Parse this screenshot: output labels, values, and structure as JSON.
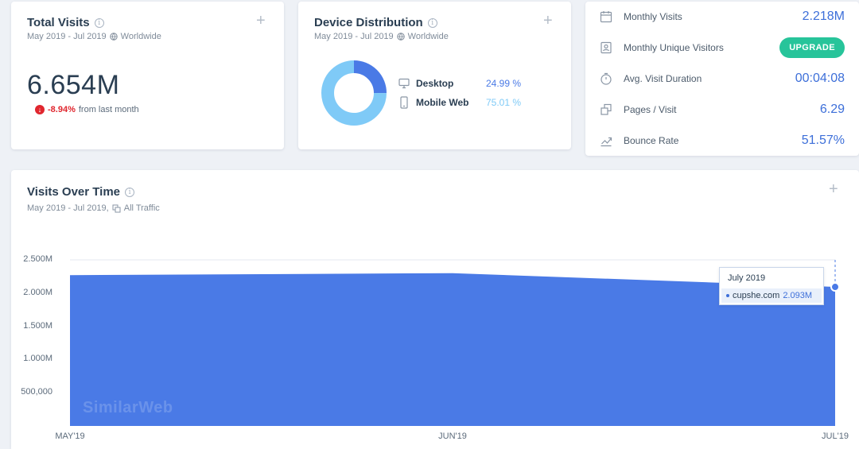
{
  "total_visits": {
    "title": "Total Visits",
    "date_range": "May 2019 - Jul 2019",
    "region": "Worldwide",
    "value": "6.654M",
    "change": "-8.94%",
    "change_suffix": "from last month"
  },
  "device_distribution": {
    "title": "Device Distribution",
    "date_range": "May 2019 - Jul 2019",
    "region": "Worldwide",
    "devices": [
      {
        "label": "Desktop",
        "value": "24.99 %",
        "share": 24.99,
        "color": "#4a7ae6"
      },
      {
        "label": "Mobile Web",
        "value": "75.01 %",
        "share": 75.01,
        "color": "#7fcaf7"
      }
    ]
  },
  "metrics": [
    {
      "label": "Monthly Visits",
      "value": "2.218M",
      "icon": "calendar-icon"
    },
    {
      "label": "Monthly Unique Visitors",
      "button": "UPGRADE",
      "icon": "person-card-icon"
    },
    {
      "label": "Avg. Visit Duration",
      "value": "00:04:08",
      "icon": "timer-icon"
    },
    {
      "label": "Pages / Visit",
      "value": "6.29",
      "icon": "pages-icon"
    },
    {
      "label": "Bounce Rate",
      "value": "51.57%",
      "icon": "bounce-icon"
    }
  ],
  "visits_over_time": {
    "title": "Visits Over Time",
    "date_range": "May 2019 - Jul 2019,",
    "traffic": "All Traffic",
    "tooltip": {
      "date": "July 2019",
      "site": "cupshe.com",
      "value": "2.093M"
    },
    "watermark": "SimilarWeb"
  },
  "chart_data": {
    "type": "area",
    "x": [
      "MAY'19",
      "JUN'19",
      "JUL'19"
    ],
    "series": [
      {
        "name": "cupshe.com",
        "values": [
          2270000,
          2300000,
          2093000
        ],
        "color": "#4a7ae6"
      }
    ],
    "y_ticks": [
      "2.500M",
      "2.000M",
      "1.500M",
      "1.000M",
      "500,000"
    ],
    "ylim": [
      0,
      2500000
    ],
    "grid": true
  },
  "colors": {
    "accent": "#3d6fd9",
    "negative": "#e0262e",
    "upgrade": "#27c49a"
  }
}
